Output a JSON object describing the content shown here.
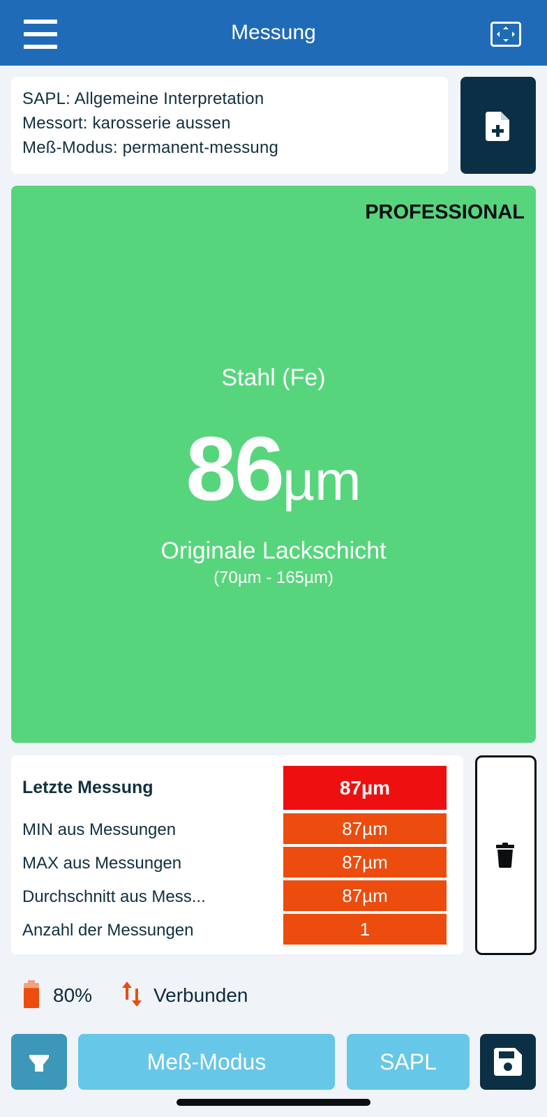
{
  "header": {
    "title": "Messung",
    "menu_icon": "hamburger-menu-icon",
    "fullscreen_icon": "fullscreen-icon"
  },
  "info": {
    "line1": "SAPL: Allgemeine Interpretation",
    "line2": "Messort: karosserie aussen",
    "line3": "Meß-Modus: permanent-messung",
    "new_doc_icon": "file-plus-icon"
  },
  "reading": {
    "edition": "PROFESSIONAL",
    "material": "Stahl (Fe)",
    "value": "86",
    "unit": "µm",
    "verdict": "Originale Lackschicht",
    "range": "(70µm - 165µm)",
    "background_color": "#57d57d"
  },
  "stats": {
    "rows": [
      {
        "label": "Letzte Messung",
        "value": "87µm"
      },
      {
        "label": "MIN aus Messungen",
        "value": "87µm"
      },
      {
        "label": "MAX aus Messungen",
        "value": "87µm"
      },
      {
        "label": "Durchschnitt aus Mess...",
        "value": "87µm"
      },
      {
        "label": "Anzahl der Messungen",
        "value": "1"
      }
    ],
    "primary_color": "#ee1010",
    "secondary_color": "#ec4c0e",
    "delete_icon": "trash-icon"
  },
  "status": {
    "battery": "80%",
    "battery_level": 0.8,
    "connection": "Verbunden",
    "battery_icon": "battery-icon",
    "connection_icon": "up-down-arrows-icon"
  },
  "bottom_bar": {
    "light_icon": "flashlight-icon",
    "mode_label": "Meß-Modus",
    "sapl_label": "SAPL",
    "save_icon": "floppy-disk-icon"
  }
}
